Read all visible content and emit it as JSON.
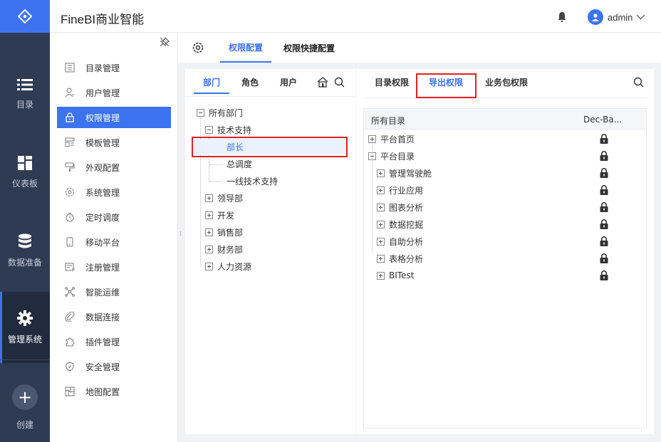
{
  "app": {
    "title": "FineBI商业智能"
  },
  "user": {
    "name": "admin"
  },
  "rail": {
    "items": [
      {
        "label": "目录",
        "icon": "list-icon"
      },
      {
        "label": "仪表板",
        "icon": "dashboard-icon"
      },
      {
        "label": "数据准备",
        "icon": "database-icon"
      },
      {
        "label": "管理系统",
        "icon": "gear-icon",
        "active": true
      }
    ],
    "create_label": "创建"
  },
  "submenu": {
    "items": [
      {
        "label": "目录管理",
        "icon": "catalog-icon"
      },
      {
        "label": "用户管理",
        "icon": "user-icon"
      },
      {
        "label": "权限管理",
        "icon": "lock-icon",
        "active": true
      },
      {
        "label": "模板管理",
        "icon": "template-icon"
      },
      {
        "label": "外观配置",
        "icon": "brush-icon"
      },
      {
        "label": "系统管理",
        "icon": "settings-icon"
      },
      {
        "label": "定时调度",
        "icon": "timer-icon"
      },
      {
        "label": "移动平台",
        "icon": "mobile-icon"
      },
      {
        "label": "注册管理",
        "icon": "register-icon"
      },
      {
        "label": "智能运维",
        "icon": "ops-icon"
      },
      {
        "label": "数据连接",
        "icon": "link-icon"
      },
      {
        "label": "插件管理",
        "icon": "plugin-icon"
      },
      {
        "label": "安全管理",
        "icon": "shield-icon"
      },
      {
        "label": "地图配置",
        "icon": "map-icon"
      }
    ]
  },
  "content_tabs": {
    "config": "权限配置",
    "quick_config": "权限快捷配置"
  },
  "left_panel": {
    "tabs": {
      "dept": "部门",
      "role": "角色",
      "user": "用户"
    },
    "tree": {
      "root": "所有部门",
      "tech": "技术支持",
      "tech_children": [
        "部长",
        "总调度",
        "一线技术支持"
      ],
      "others": [
        "领导部",
        "开发",
        "销售部",
        "财务部",
        "人力资源"
      ]
    }
  },
  "right_panel": {
    "tabs": {
      "catalog": "目录权限",
      "export": "导出权限",
      "package": "业务包权限"
    },
    "grid": {
      "col_catalog": "所有目录",
      "col_role": "Dec-Ba...",
      "rows": {
        "home": "平台首页",
        "catalog": "平台目录",
        "catalog_children": [
          "管理驾驶舱",
          "行业应用",
          "图表分析",
          "数据挖掘",
          "自助分析",
          "表格分析",
          "BITest"
        ]
      }
    }
  },
  "colors": {
    "accent": "#3d73f0",
    "rail": "#2f3b52",
    "highlight": "#e02020"
  }
}
